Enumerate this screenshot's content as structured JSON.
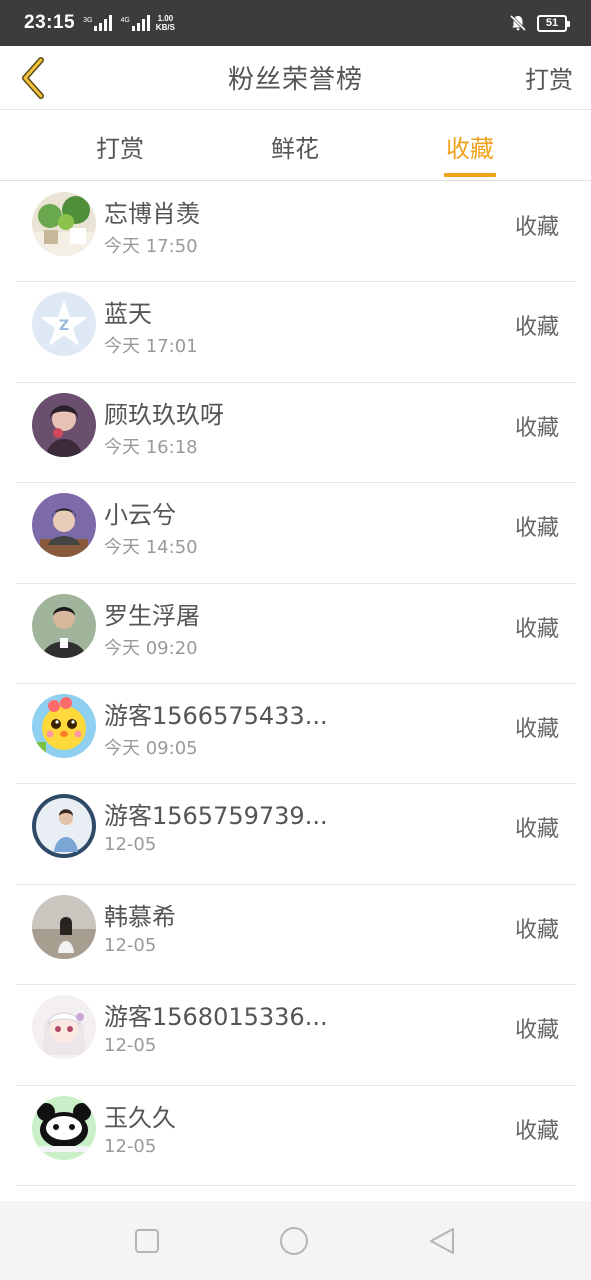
{
  "status_bar": {
    "time": "23:15",
    "net1": "3G",
    "net2": "4G",
    "speed_value": "1.00",
    "speed_unit": "KB/S",
    "battery": "51"
  },
  "header": {
    "title": "粉丝荣誉榜",
    "right_action": "打赏"
  },
  "tabs": [
    {
      "label": "打赏",
      "active": false
    },
    {
      "label": "鲜花",
      "active": false
    },
    {
      "label": "收藏",
      "active": true
    }
  ],
  "colors": {
    "accent": "#f0a21e",
    "status_bar": "#3c3c3c"
  },
  "fans": [
    {
      "name": "忘博肖羡",
      "time": "今天 17:50",
      "action": "收藏",
      "avatar": "plants-avatar"
    },
    {
      "name": "蓝天",
      "time": "今天 17:01",
      "action": "收藏",
      "avatar": "qzone-star-avatar"
    },
    {
      "name": "顾玖玖玖呀",
      "time": "今天 16:18",
      "action": "收藏",
      "avatar": "girl-photo-avatar"
    },
    {
      "name": "小云兮",
      "time": "今天 14:50",
      "action": "收藏",
      "avatar": "boy-photo-avatar"
    },
    {
      "name": "罗生浮屠",
      "time": "今天 09:20",
      "action": "收藏",
      "avatar": "man-photo-avatar"
    },
    {
      "name": "游客1566575433...",
      "time": "今天 09:05",
      "action": "收藏",
      "avatar": "cartoon-chick-avatar"
    },
    {
      "name": "游客1565759739...",
      "time": "12-05",
      "action": "收藏",
      "avatar": "girl-circle-avatar"
    },
    {
      "name": "韩慕希",
      "time": "12-05",
      "action": "收藏",
      "avatar": "beach-girl-avatar"
    },
    {
      "name": "游客1568015336...",
      "time": "12-05",
      "action": "收藏",
      "avatar": "anime-girl-avatar"
    },
    {
      "name": "玉久久",
      "time": "12-05",
      "action": "收藏",
      "avatar": "panda-avatar"
    }
  ],
  "nav": {
    "icons": [
      "square-icon",
      "circle-icon",
      "triangle-back-icon"
    ]
  }
}
